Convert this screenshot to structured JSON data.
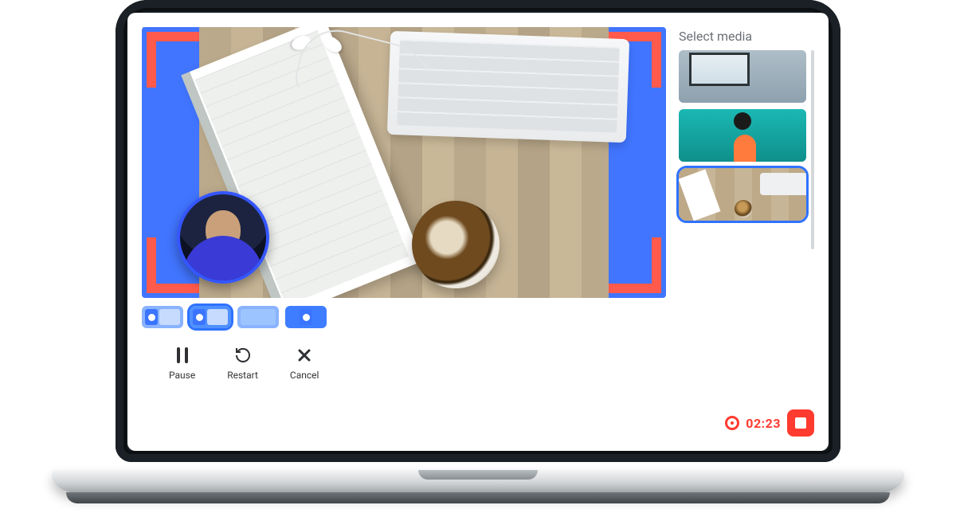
{
  "close_label": "×",
  "sidebar": {
    "title": "Select media"
  },
  "controls": {
    "pause": "Pause",
    "restart": "Restart",
    "cancel": "Cancel"
  },
  "recording": {
    "time": "02:23"
  },
  "media_thumbs": [
    {
      "id": "room-window"
    },
    {
      "id": "kayak"
    },
    {
      "id": "desk"
    }
  ],
  "layouts": [
    "pip-left",
    "pip-left-wide",
    "split",
    "solo"
  ],
  "selected_layout_index": 1,
  "selected_thumb_index": 2
}
